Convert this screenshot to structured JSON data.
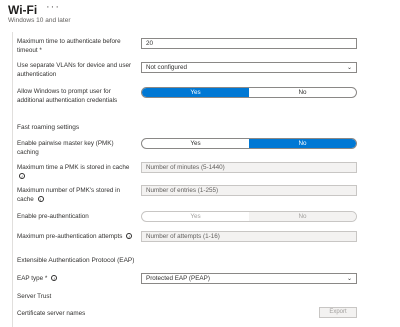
{
  "header": {
    "title": "Wi-Fi",
    "more": "···",
    "subtitle": "Windows 10 and later"
  },
  "fields": {
    "max_auth_time": {
      "label": "Maximum time to authenticate before timeout",
      "required": "*",
      "value": "20"
    },
    "separate_vlans": {
      "label": "Use separate VLANs for device and user authentication",
      "value": "Not configured"
    },
    "prompt_creds": {
      "label": "Allow Windows to prompt user for additional authentication credentials",
      "yes": "Yes",
      "no": "No"
    },
    "fast_roaming": {
      "heading": "Fast roaming settings"
    },
    "pmk_caching": {
      "label": "Enable pairwise master key (PMK) caching",
      "yes": "Yes",
      "no": "No"
    },
    "pmk_time": {
      "label": "Maximum time a PMK is stored in cache",
      "placeholder": "Number of minutes (5-1440)"
    },
    "pmk_count": {
      "label": "Maximum number of PMK's stored in cache",
      "placeholder": "Number of entries (1-255)"
    },
    "preauth": {
      "label": "Enable pre-authentication",
      "yes": "Yes",
      "no": "No"
    },
    "preauth_attempts": {
      "label": "Maximum pre-authentication attempts",
      "placeholder": "Number of attempts (1-16)"
    },
    "eap": {
      "heading": "Extensible Authentication Protocol (EAP)"
    },
    "eap_type": {
      "label": "EAP type",
      "required": "*",
      "value": "Protected EAP (PEAP)"
    },
    "server_trust": {
      "label": "Server Trust"
    },
    "cert_server_names": {
      "label": "Certificate server names",
      "button": "Export"
    }
  }
}
